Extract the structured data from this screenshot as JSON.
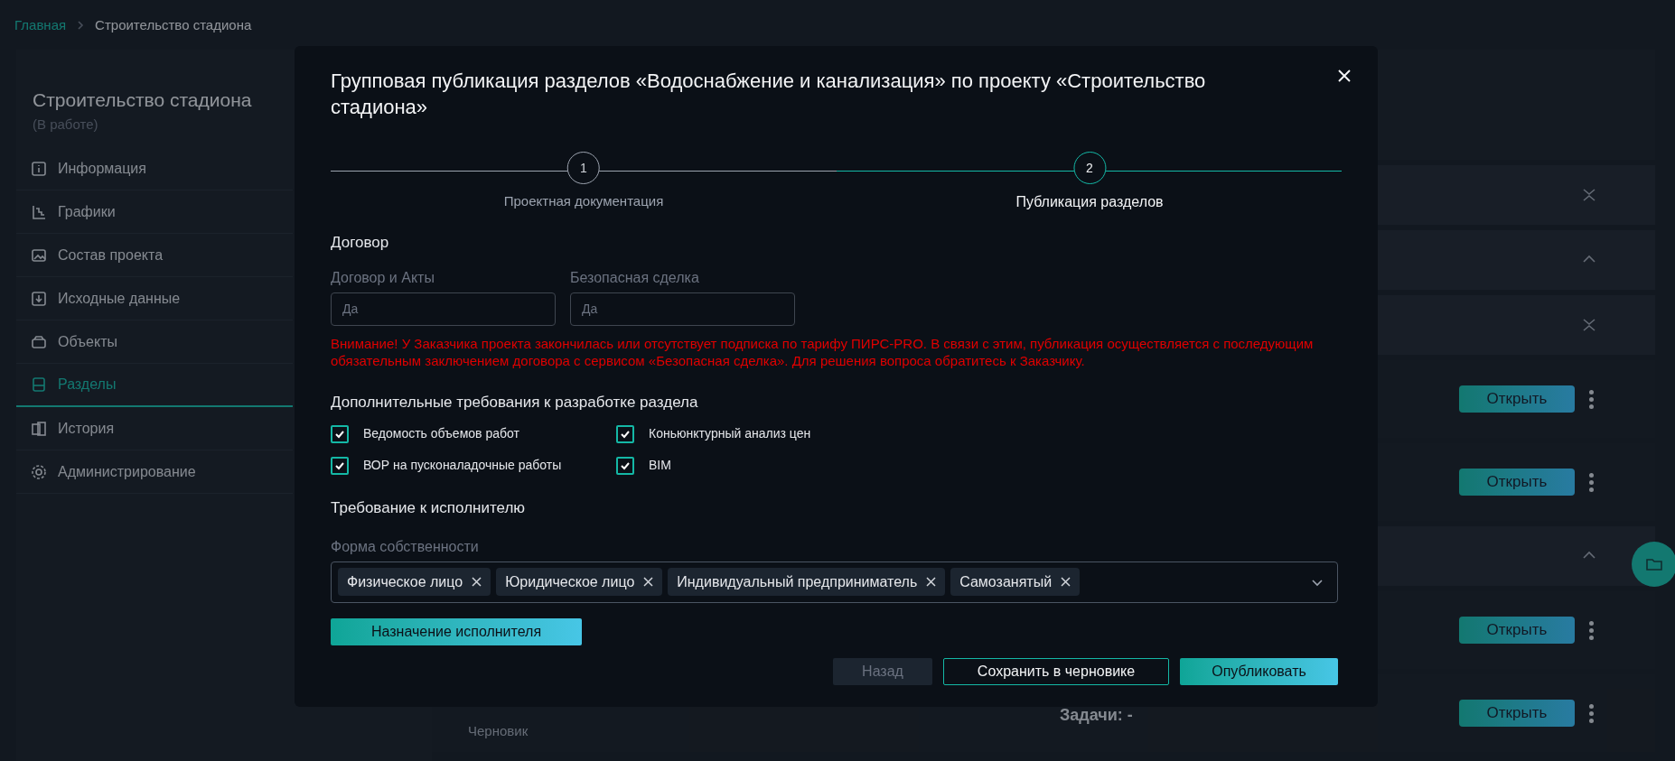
{
  "breadcrumbs": [
    {
      "label": "Главная",
      "current": false
    },
    {
      "label": "Строительство стадиона",
      "current": true
    }
  ],
  "project": {
    "title": "Строительство стадиона",
    "status": "(В работе)"
  },
  "sidebar": {
    "items": [
      {
        "label": "Информация",
        "selected": false
      },
      {
        "label": "Графики",
        "selected": false
      },
      {
        "label": "Состав проекта",
        "selected": false
      },
      {
        "label": "Исходные данные",
        "selected": false
      },
      {
        "label": "Объекты",
        "selected": false
      },
      {
        "label": "Разделы",
        "selected": true
      },
      {
        "label": "История",
        "selected": false
      },
      {
        "label": "Администрирование",
        "selected": false
      }
    ]
  },
  "background_list": {
    "rows": [
      {
        "kind": "group"
      },
      {
        "kind": "group"
      },
      {
        "kind": "group"
      },
      {
        "kind": "item",
        "button": "Открыть"
      },
      {
        "kind": "item",
        "button": "Открыть"
      },
      {
        "kind": "group"
      },
      {
        "kind": "item",
        "button": "Открыть"
      },
      {
        "kind": "item",
        "button": "Открыть",
        "status": "Черновик",
        "tasks": "Задачи: -"
      }
    ]
  },
  "dialog": {
    "title": "Групповая публикация разделов «Водоснабжение и канализация» по проекту «Строительство стадиона»",
    "steps": [
      {
        "number": "1",
        "label": "Проектная документация",
        "selected": false
      },
      {
        "number": "2",
        "label": "Публикация разделов",
        "selected": true
      }
    ],
    "contract": {
      "heading": "Договор",
      "fields": [
        {
          "label": "Договор и Акты",
          "placeholder": "Да"
        },
        {
          "label": "Безопасная сделка",
          "placeholder": "Да"
        }
      ],
      "warning": "Внимание! У Заказчика проекта закончилась или отсутствует подписка по тарифу ПИРС-PRO. В связи с этим, публикация осуществляется с последующим обязательным заключением договора с сервисом «Безопасная сделка». Для решения вопроса обратитесь к Заказчику."
    },
    "requirements": {
      "heading": "Дополнительные требования к разработке раздела",
      "options": [
        {
          "label": "Ведомость объемов работ",
          "checked": true
        },
        {
          "label": "Коньюнктурный анализ цен",
          "checked": true
        },
        {
          "label": "ВОР на пусконаладочные работы",
          "checked": true
        },
        {
          "label": "BIM",
          "checked": true
        }
      ]
    },
    "executor": {
      "heading": "Требование к исполнителю",
      "field_label": "Форма собственности",
      "tags": [
        "Физическое лицо",
        "Юридическое лицо",
        "Индивидуальный предприниматель",
        "Самозанятый"
      ],
      "assign_button": "Назначение исполнителя"
    },
    "buttons": [
      {
        "label": "Назад",
        "kind": "disabled"
      },
      {
        "label": "Сохранить в черновике",
        "kind": "outline"
      },
      {
        "label": "Опубликовать",
        "kind": "primary"
      }
    ]
  }
}
